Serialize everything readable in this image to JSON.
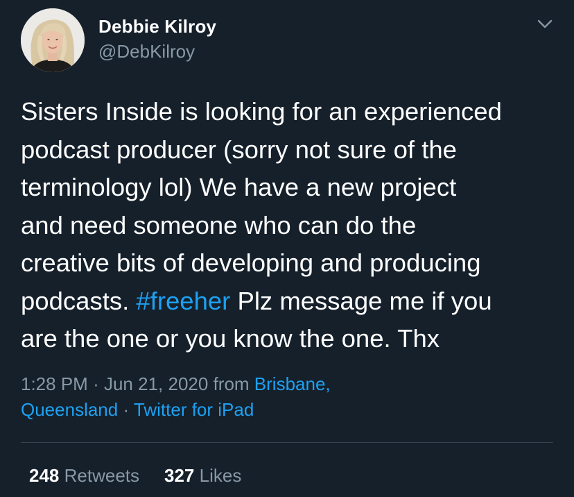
{
  "author": {
    "name": "Debbie Kilroy",
    "handle": "@DebKilroy"
  },
  "tweet": {
    "lines": [
      "Sisters Inside is looking for an experienced",
      "podcast producer (sorry not sure of the",
      "terminology lol) We have a new project",
      "and need someone who can do the",
      "creative bits of developing and producing"
    ],
    "line6_before": "podcasts. ",
    "hashtag": "#freeher",
    "line6_after": " Plz message me if you",
    "line7": "are the one or you know the one. Thx"
  },
  "meta": {
    "time": "1:28 PM",
    "separator": "·",
    "date": "Jun 21, 2020",
    "from_label": "from",
    "location_line1": "Brisbane,",
    "location_line2": "Queensland",
    "source": "Twitter for iPad"
  },
  "stats": {
    "retweets_count": "248",
    "retweets_label": "Retweets",
    "likes_count": "327",
    "likes_label": "Likes"
  },
  "colors": {
    "background": "#15202b",
    "text": "#ffffff",
    "secondary": "#8899a6",
    "link": "#1da1f2",
    "divider": "#38444d"
  },
  "icons": {
    "avatar": "avatar",
    "menu": "chevron-down-icon"
  }
}
